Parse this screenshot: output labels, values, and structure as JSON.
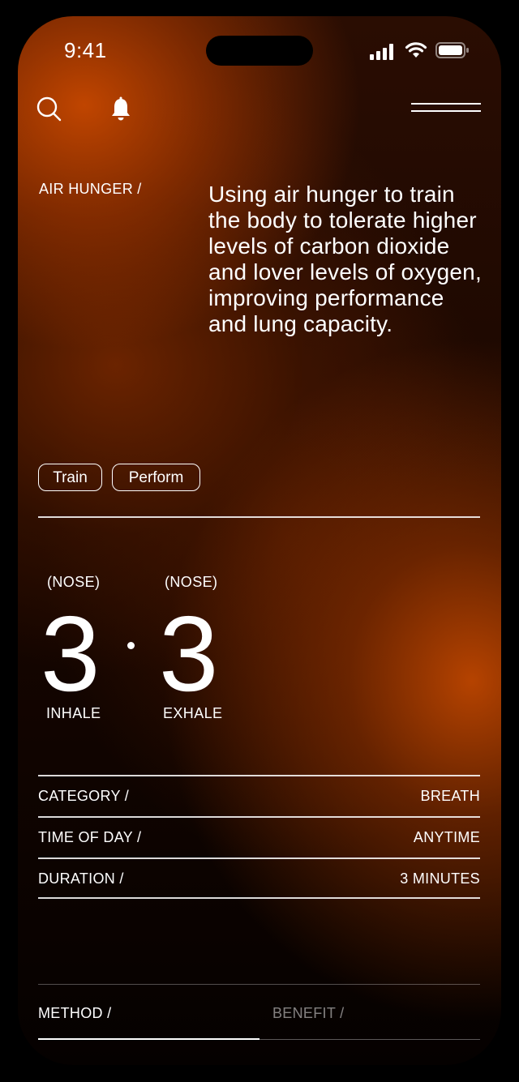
{
  "status_bar": {
    "time": "9:41"
  },
  "header": {
    "search_icon": "search-icon",
    "notification_icon": "bell-icon",
    "menu_icon": "menu-icon"
  },
  "exercise": {
    "kicker": "AIR HUNGER /",
    "description": "Using air hunger to train the body to tolerate higher levels of carbon dioxide and lover levels of oxygen, improving performance and lung capacity.",
    "tags": [
      "Train",
      "Perform"
    ]
  },
  "breathing": {
    "inhale": {
      "mode": "(NOSE)",
      "count": "3",
      "label": "INHALE"
    },
    "exhale": {
      "mode": "(NOSE)",
      "count": "3",
      "label": "EXHALE"
    }
  },
  "details": [
    {
      "label": "CATEGORY /",
      "value": "BREATH"
    },
    {
      "label": "TIME OF DAY /",
      "value": "ANYTIME"
    },
    {
      "label": "DURATION /",
      "value": "3 MINUTES"
    }
  ],
  "tabs": [
    {
      "label": "METHOD /",
      "active": true
    },
    {
      "label": "BENEFIT /",
      "active": false
    }
  ],
  "colors": {
    "accent": "#c54800",
    "background": "#000000",
    "text": "#ffffff"
  }
}
